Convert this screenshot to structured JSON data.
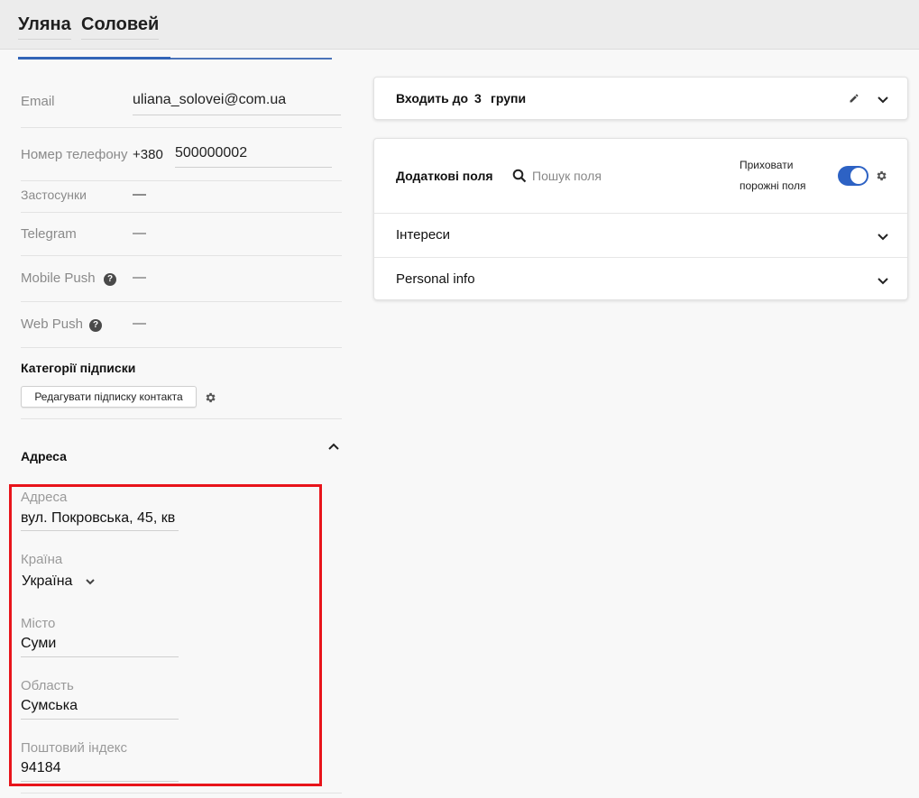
{
  "header": {
    "first_name": "Уляна",
    "last_name": "Соловей"
  },
  "contact": {
    "email_label": "Email",
    "email_value": "uliana_solovei@com.ua",
    "phone_label": "Номер телефону",
    "phone_code": "+380",
    "phone_number": "500000002",
    "apps_label": "Застосунки",
    "apps_value": "—",
    "telegram_label": "Telegram",
    "telegram_value": "—",
    "mobile_push_label": "Mobile Push",
    "mobile_push_value": "—",
    "web_push_label": "Web Push",
    "web_push_value": "—",
    "help_glyph": "?"
  },
  "subscriptions": {
    "title": "Категорії підписки",
    "edit_button": "Редагувати підписку контакта"
  },
  "address": {
    "section_title": "Адреса",
    "address_label": "Адреса",
    "address_value": "вул. Покровська, 45, кв",
    "country_label": "Країна",
    "country_value": "Україна",
    "city_label": "Місто",
    "city_value": "Суми",
    "region_label": "Область",
    "region_value": "Сумська",
    "postal_label": "Поштовий індекс",
    "postal_value": "94184"
  },
  "groups_card": {
    "prefix": "Входить до",
    "count": "3",
    "suffix": "групи"
  },
  "extra_fields_card": {
    "title": "Додаткові поля",
    "search_placeholder": "Пошук поля",
    "hide_empty_line1": "Приховати",
    "hide_empty_line2": "порожні поля",
    "hide_empty_enabled": true,
    "rows": [
      {
        "label": "Інтереси"
      },
      {
        "label": "Personal info"
      }
    ]
  },
  "colors": {
    "accent": "#2d62c4",
    "highlight_border": "#e8141b"
  }
}
